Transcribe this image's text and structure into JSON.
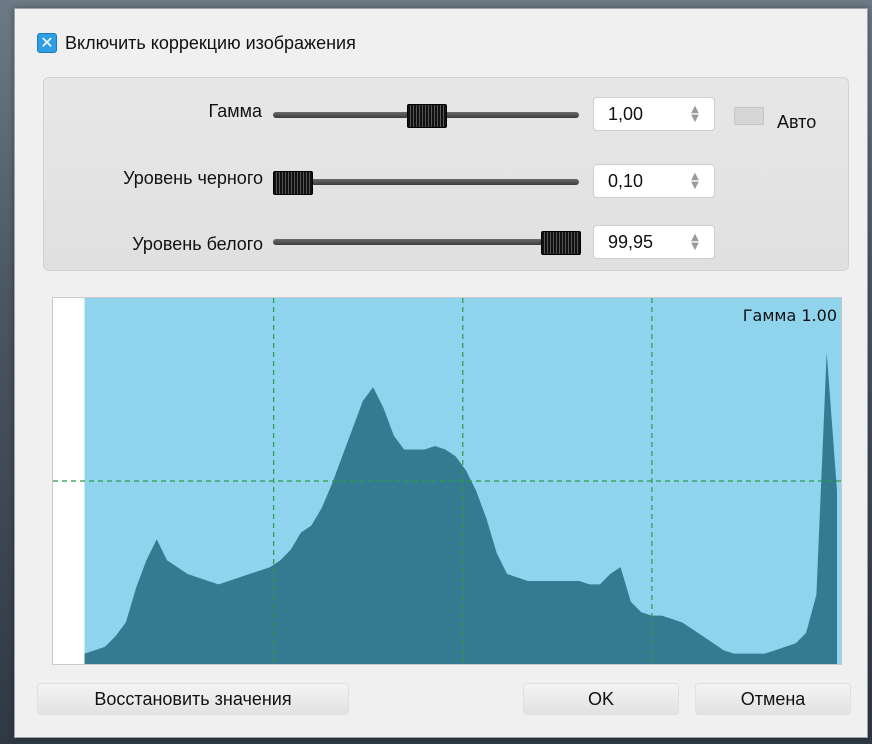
{
  "enable_correction": {
    "label": "Включить коррекцию изображения",
    "checked": true
  },
  "gamma": {
    "label": "Гамма",
    "value_text": "1,00",
    "slider_fraction": 0.5
  },
  "auto": {
    "label": "Авто",
    "checked": false
  },
  "black_level": {
    "label": "Уровень черного",
    "value_text": "0,10",
    "slider_fraction": 0.0
  },
  "white_level": {
    "label": "Уровень белого",
    "value_text": "99,95",
    "slider_fraction": 1.0
  },
  "histogram": {
    "label": "Гамма 1.00",
    "colors": {
      "background": "#8fd4ec",
      "fill": "#347a91",
      "grid": "#2a9a4a",
      "clipped": "#ffffff"
    },
    "clipped_left_fraction": 0.04,
    "grid_v_fractions": [
      0.25,
      0.5,
      0.75
    ],
    "grid_h_fraction": 0.5,
    "profile": [
      0.03,
      0.04,
      0.05,
      0.08,
      0.12,
      0.22,
      0.3,
      0.36,
      0.3,
      0.28,
      0.26,
      0.25,
      0.24,
      0.23,
      0.24,
      0.25,
      0.26,
      0.27,
      0.28,
      0.3,
      0.33,
      0.38,
      0.4,
      0.45,
      0.52,
      0.6,
      0.68,
      0.76,
      0.8,
      0.74,
      0.66,
      0.62,
      0.62,
      0.62,
      0.63,
      0.62,
      0.6,
      0.56,
      0.5,
      0.42,
      0.32,
      0.26,
      0.25,
      0.24,
      0.24,
      0.24,
      0.24,
      0.24,
      0.24,
      0.23,
      0.23,
      0.26,
      0.28,
      0.18,
      0.15,
      0.14,
      0.14,
      0.13,
      0.12,
      0.1,
      0.08,
      0.06,
      0.04,
      0.03,
      0.03,
      0.03,
      0.03,
      0.04,
      0.05,
      0.06,
      0.09,
      0.2,
      0.9,
      0.5
    ]
  },
  "buttons": {
    "restore": "Восстановить значения",
    "ok": "OK",
    "cancel": "Отмена"
  },
  "spin_arrows": {
    "up": "▲",
    "down": "▼"
  }
}
